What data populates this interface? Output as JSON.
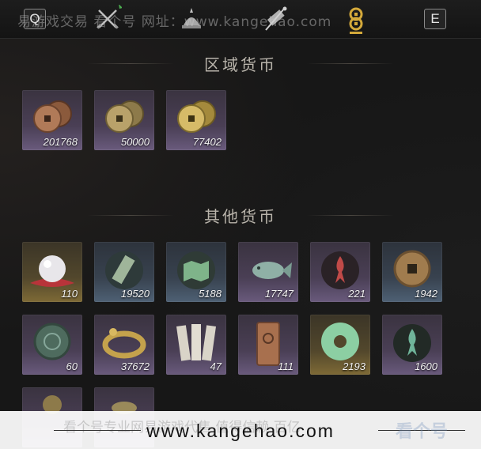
{
  "topbar": {
    "left_key": "Q",
    "right_key": "E",
    "tabs": [
      {
        "icon": "crossed-swords-icon",
        "active": false
      },
      {
        "icon": "helmet-armor-icon",
        "active": false
      },
      {
        "icon": "scroll-brush-icon",
        "active": false
      },
      {
        "icon": "coin-stack-icon",
        "active": true
      }
    ],
    "watermark": "易游戏交易 看个号 网址：www.kangehao.com",
    "accent_color": "#d4a93a"
  },
  "sections": [
    {
      "title": "区域货币",
      "items": [
        {
          "icon": "copper-coins-icon",
          "count": "201768",
          "rarity": "purple"
        },
        {
          "icon": "bronze-coins-icon",
          "count": "50000",
          "rarity": "purple"
        },
        {
          "icon": "gold-coins-icon",
          "count": "77402",
          "rarity": "purple"
        }
      ]
    },
    {
      "title": "其他货币",
      "items": [
        {
          "icon": "pearl-icon",
          "count": "110",
          "rarity": "gold"
        },
        {
          "icon": "jade-token-icon",
          "count": "19520",
          "rarity": "blue"
        },
        {
          "icon": "map-scroll-icon",
          "count": "5188",
          "rarity": "blue"
        },
        {
          "icon": "jade-fish-icon",
          "count": "17747",
          "rarity": "purple"
        },
        {
          "icon": "red-flame-sigil-icon",
          "count": "221",
          "rarity": "purple"
        },
        {
          "icon": "square-hole-coin-icon",
          "count": "1942",
          "rarity": "blue"
        },
        {
          "icon": "jade-disc-icon",
          "count": "60",
          "rarity": "purple"
        },
        {
          "icon": "serpent-bracelet-icon",
          "count": "37672",
          "rarity": "purple"
        },
        {
          "icon": "talisman-slips-icon",
          "count": "47",
          "rarity": "purple"
        },
        {
          "icon": "bronze-tablet-icon",
          "count": "111",
          "rarity": "purple"
        },
        {
          "icon": "jade-ring-icon",
          "count": "2193",
          "rarity": "gold"
        },
        {
          "icon": "green-flame-sigil-icon",
          "count": "1600",
          "rarity": "purple"
        }
      ]
    }
  ],
  "bottom_watermark": {
    "url": "www.kangehao.com",
    "faint_text": "看个号专业网易游戏代售 值得信赖 百亿",
    "logo_text": "看个号"
  }
}
